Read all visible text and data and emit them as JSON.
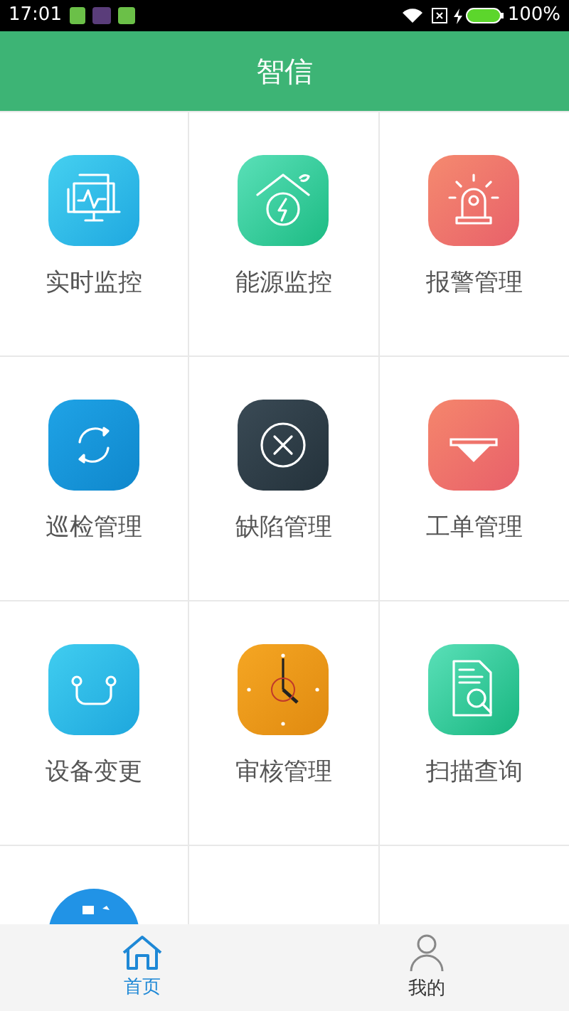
{
  "status_bar": {
    "time": "17:01",
    "battery": "100%"
  },
  "header": {
    "title": "智信"
  },
  "grid": [
    {
      "label": "实时监控",
      "kind": "monitor"
    },
    {
      "label": "能源监控",
      "kind": "energy"
    },
    {
      "label": "报警管理",
      "kind": "alarm"
    },
    {
      "label": "巡检管理",
      "kind": "cycle"
    },
    {
      "label": "缺陷管理",
      "kind": "defect"
    },
    {
      "label": "工单管理",
      "kind": "order"
    },
    {
      "label": "设备变更",
      "kind": "change"
    },
    {
      "label": "审核管理",
      "kind": "clock"
    },
    {
      "label": "扫描查询",
      "kind": "scan"
    },
    {
      "kind": "partial"
    }
  ],
  "tabs": [
    {
      "label": "首页",
      "kind": "home",
      "selected": true
    },
    {
      "label": "我的",
      "kind": "user",
      "selected": false
    }
  ]
}
